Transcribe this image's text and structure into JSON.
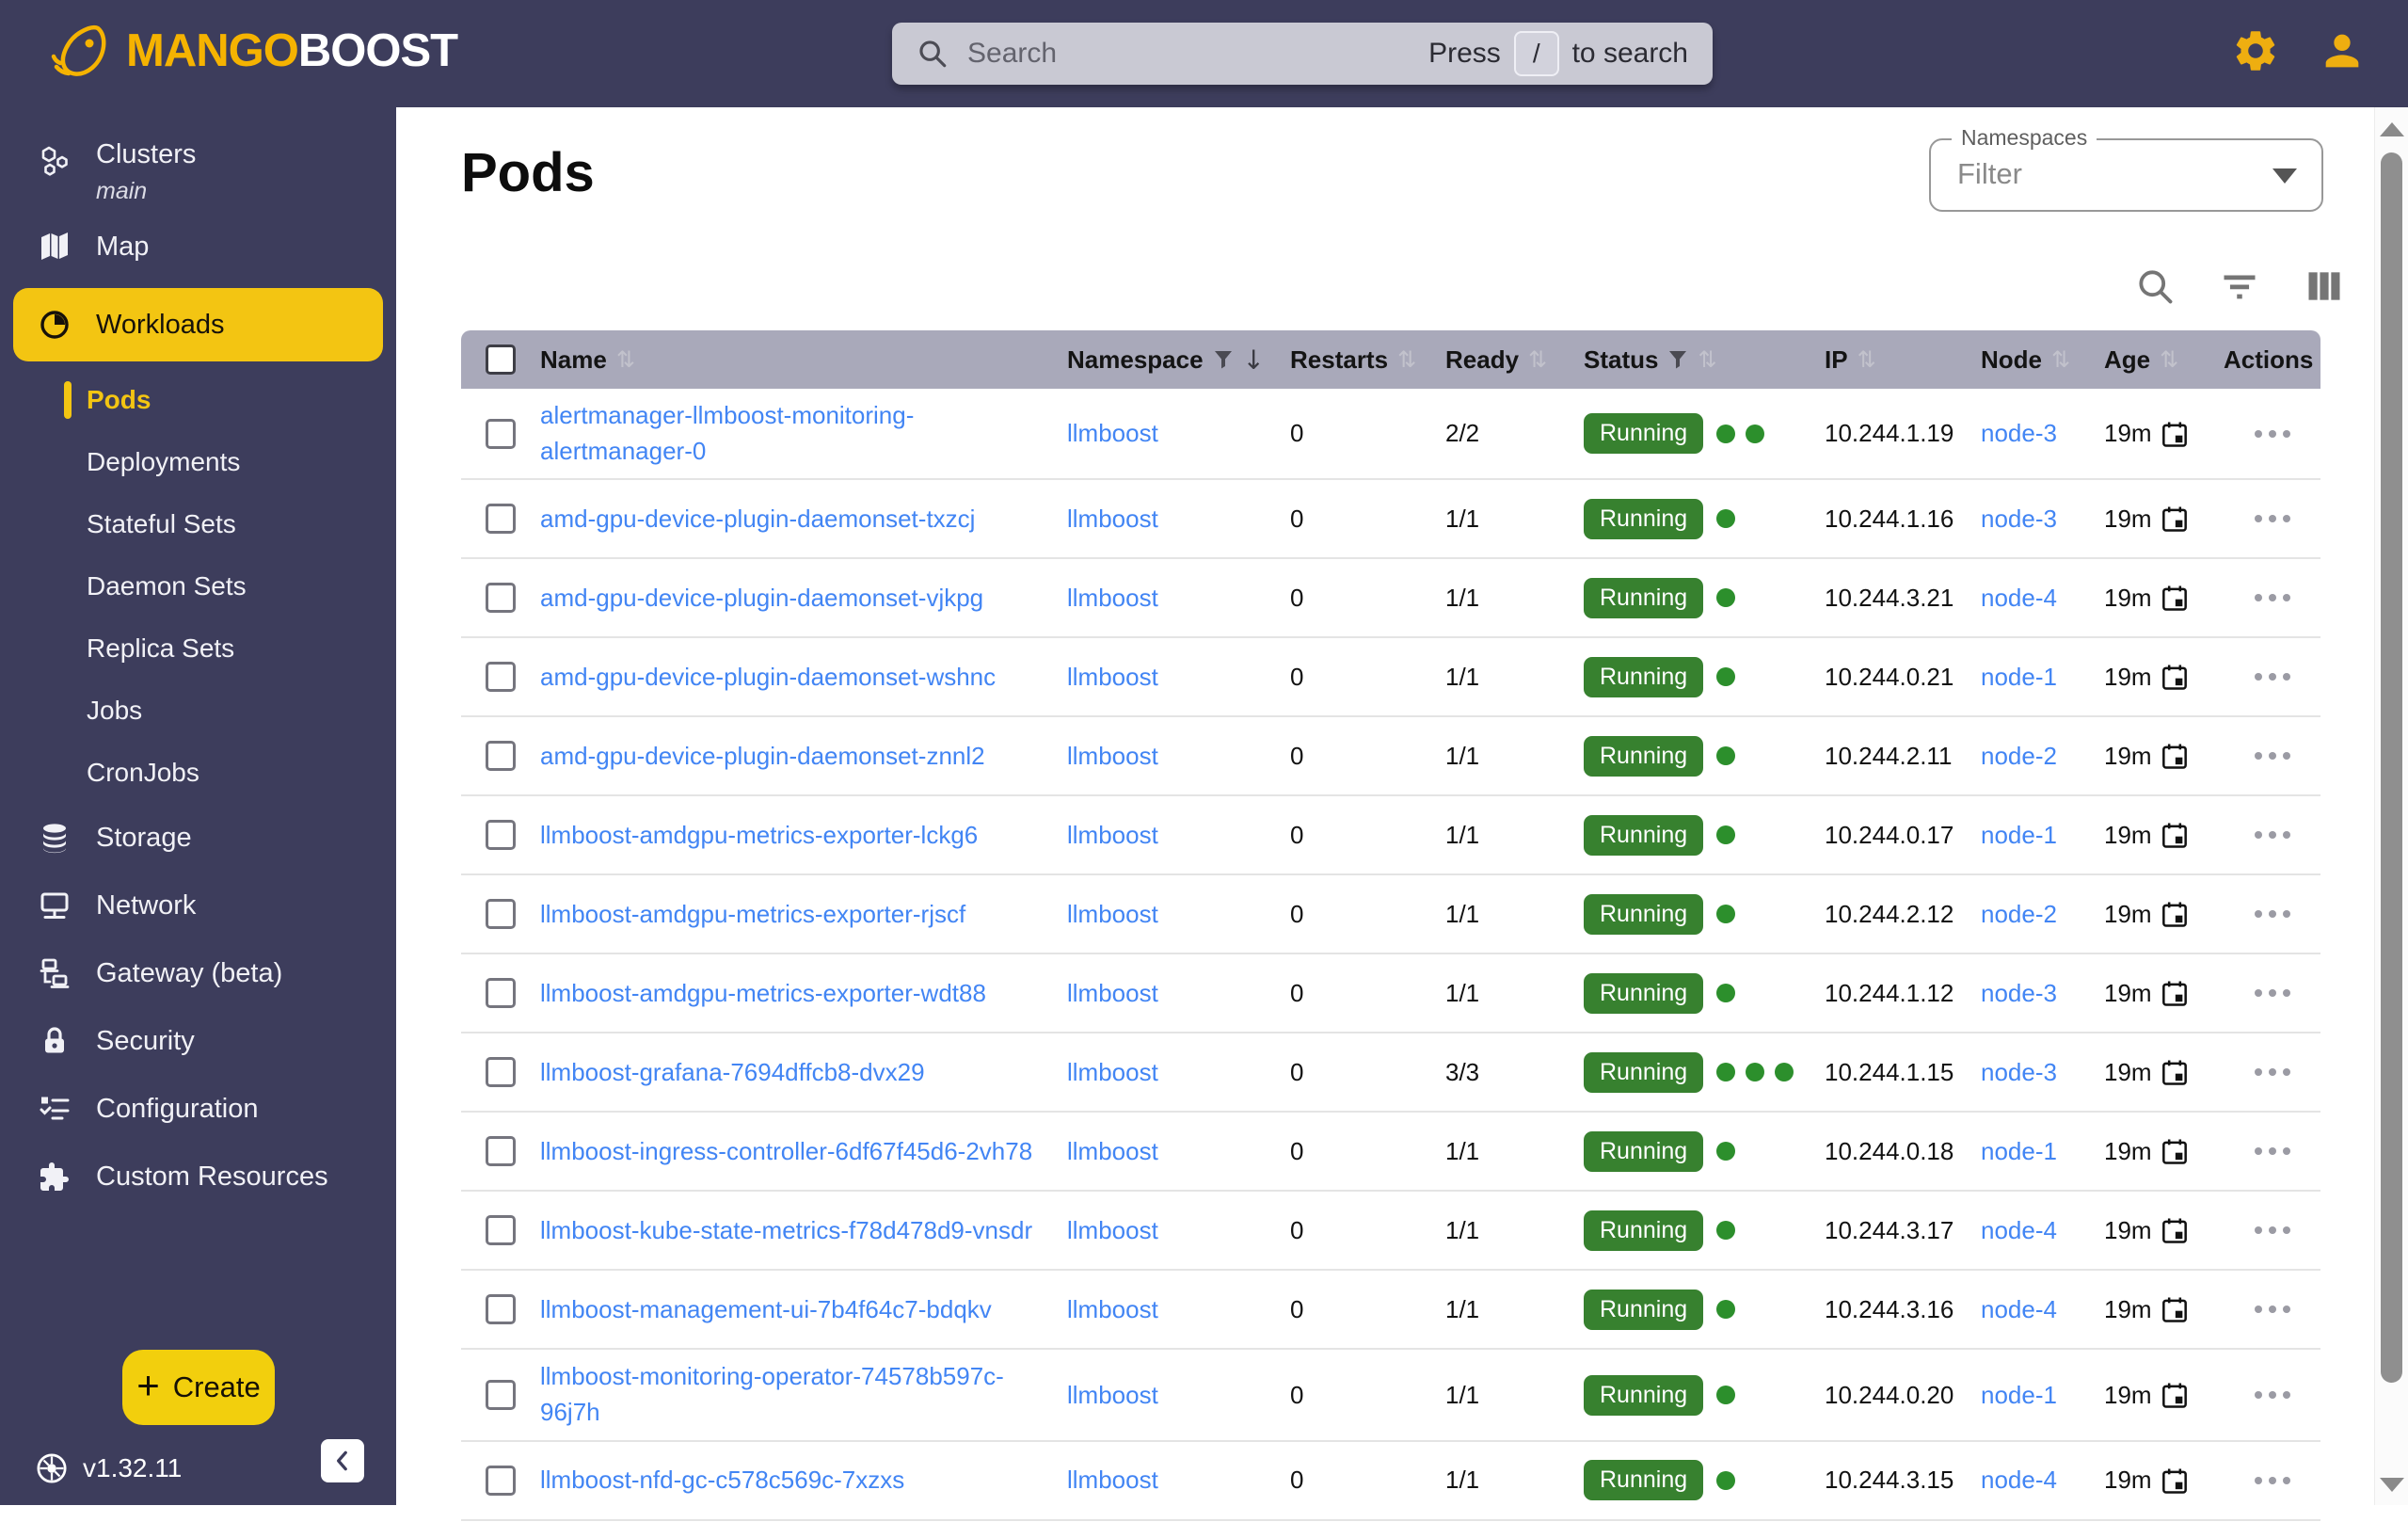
{
  "topbar": {
    "brand_mango": "MANGO",
    "brand_boost": "BOOST",
    "search": {
      "placeholder": "Search",
      "press": "Press",
      "key": "/",
      "to_search": "to search"
    }
  },
  "sidebar": {
    "items": [
      {
        "label": "Clusters",
        "sub": "main",
        "icon": "clusters-icon"
      },
      {
        "label": "Map",
        "icon": "map-icon"
      },
      {
        "label": "Workloads",
        "icon": "workloads-icon",
        "selected": true
      },
      {
        "label": "Storage",
        "icon": "storage-icon"
      },
      {
        "label": "Network",
        "icon": "network-icon"
      },
      {
        "label": "Gateway (beta)",
        "icon": "gateway-icon"
      },
      {
        "label": "Security",
        "icon": "security-icon"
      },
      {
        "label": "Configuration",
        "icon": "configuration-icon"
      },
      {
        "label": "Custom Resources",
        "icon": "custom-resources-icon"
      }
    ],
    "workloads_children": [
      {
        "label": "Pods",
        "active": true
      },
      {
        "label": "Deployments"
      },
      {
        "label": "Stateful Sets"
      },
      {
        "label": "Daemon Sets"
      },
      {
        "label": "Replica Sets"
      },
      {
        "label": "Jobs"
      },
      {
        "label": "CronJobs"
      }
    ],
    "create_label": "Create",
    "create_plus": "+",
    "version": "v1.32.11"
  },
  "main": {
    "title": "Pods",
    "namespace_filter": {
      "label": "Namespaces",
      "value": "Filter"
    },
    "toolbar_icons": [
      "search-icon",
      "filter-icon",
      "columns-icon"
    ],
    "table": {
      "columns": [
        {
          "label": "Name",
          "sort": true
        },
        {
          "label": "Namespace",
          "filter": true,
          "sorted": "desc"
        },
        {
          "label": "Restarts",
          "sort": true
        },
        {
          "label": "Ready",
          "sort": true
        },
        {
          "label": "Status",
          "filter": true,
          "sort": true
        },
        {
          "label": "IP",
          "sort": true
        },
        {
          "label": "Node",
          "sort": true
        },
        {
          "label": "Age",
          "sort": true
        },
        {
          "label": "Actions"
        }
      ],
      "rows": [
        {
          "name": "alertmanager-llmboost-monitoring-alertmanager-0",
          "namespace": "llmboost",
          "restarts": "0",
          "ready": "2/2",
          "status": "Running",
          "dots": 2,
          "ip": "10.244.1.19",
          "node": "node-3",
          "age": "19m"
        },
        {
          "name": "amd-gpu-device-plugin-daemonset-txzcj",
          "namespace": "llmboost",
          "restarts": "0",
          "ready": "1/1",
          "status": "Running",
          "dots": 1,
          "ip": "10.244.1.16",
          "node": "node-3",
          "age": "19m"
        },
        {
          "name": "amd-gpu-device-plugin-daemonset-vjkpg",
          "namespace": "llmboost",
          "restarts": "0",
          "ready": "1/1",
          "status": "Running",
          "dots": 1,
          "ip": "10.244.3.21",
          "node": "node-4",
          "age": "19m"
        },
        {
          "name": "amd-gpu-device-plugin-daemonset-wshnc",
          "namespace": "llmboost",
          "restarts": "0",
          "ready": "1/1",
          "status": "Running",
          "dots": 1,
          "ip": "10.244.0.21",
          "node": "node-1",
          "age": "19m"
        },
        {
          "name": "amd-gpu-device-plugin-daemonset-znnl2",
          "namespace": "llmboost",
          "restarts": "0",
          "ready": "1/1",
          "status": "Running",
          "dots": 1,
          "ip": "10.244.2.11",
          "node": "node-2",
          "age": "19m"
        },
        {
          "name": "llmboost-amdgpu-metrics-exporter-lckg6",
          "namespace": "llmboost",
          "restarts": "0",
          "ready": "1/1",
          "status": "Running",
          "dots": 1,
          "ip": "10.244.0.17",
          "node": "node-1",
          "age": "19m"
        },
        {
          "name": "llmboost-amdgpu-metrics-exporter-rjscf",
          "namespace": "llmboost",
          "restarts": "0",
          "ready": "1/1",
          "status": "Running",
          "dots": 1,
          "ip": "10.244.2.12",
          "node": "node-2",
          "age": "19m"
        },
        {
          "name": "llmboost-amdgpu-metrics-exporter-wdt88",
          "namespace": "llmboost",
          "restarts": "0",
          "ready": "1/1",
          "status": "Running",
          "dots": 1,
          "ip": "10.244.1.12",
          "node": "node-3",
          "age": "19m"
        },
        {
          "name": "llmboost-grafana-7694dffcb8-dvx29",
          "namespace": "llmboost",
          "restarts": "0",
          "ready": "3/3",
          "status": "Running",
          "dots": 3,
          "ip": "10.244.1.15",
          "node": "node-3",
          "age": "19m"
        },
        {
          "name": "llmboost-ingress-controller-6df67f45d6-2vh78",
          "namespace": "llmboost",
          "restarts": "0",
          "ready": "1/1",
          "status": "Running",
          "dots": 1,
          "ip": "10.244.0.18",
          "node": "node-1",
          "age": "19m"
        },
        {
          "name": "llmboost-kube-state-metrics-f78d478d9-vnsdr",
          "namespace": "llmboost",
          "restarts": "0",
          "ready": "1/1",
          "status": "Running",
          "dots": 1,
          "ip": "10.244.3.17",
          "node": "node-4",
          "age": "19m"
        },
        {
          "name": "llmboost-management-ui-7b4f64c7-bdqkv",
          "namespace": "llmboost",
          "restarts": "0",
          "ready": "1/1",
          "status": "Running",
          "dots": 1,
          "ip": "10.244.3.16",
          "node": "node-4",
          "age": "19m"
        },
        {
          "name": "llmboost-monitoring-operator-74578b597c-96j7h",
          "namespace": "llmboost",
          "restarts": "0",
          "ready": "1/1",
          "status": "Running",
          "dots": 1,
          "ip": "10.244.0.20",
          "node": "node-1",
          "age": "19m"
        },
        {
          "name": "llmboost-nfd-gc-c578c569c-7xzxs",
          "namespace": "llmboost",
          "restarts": "0",
          "ready": "1/1",
          "status": "Running",
          "dots": 1,
          "ip": "10.244.3.15",
          "node": "node-4",
          "age": "19m"
        }
      ]
    }
  },
  "colors": {
    "navy": "#3d3d5c",
    "brand_yellow": "#f5b301",
    "selected_yellow": "#f3c512",
    "create_yellow": "#f2cf0d",
    "link_blue": "#4285f4",
    "status_green": "#37812f",
    "dot_green": "#2c8f2c",
    "header_gray": "#a9a9ba"
  }
}
